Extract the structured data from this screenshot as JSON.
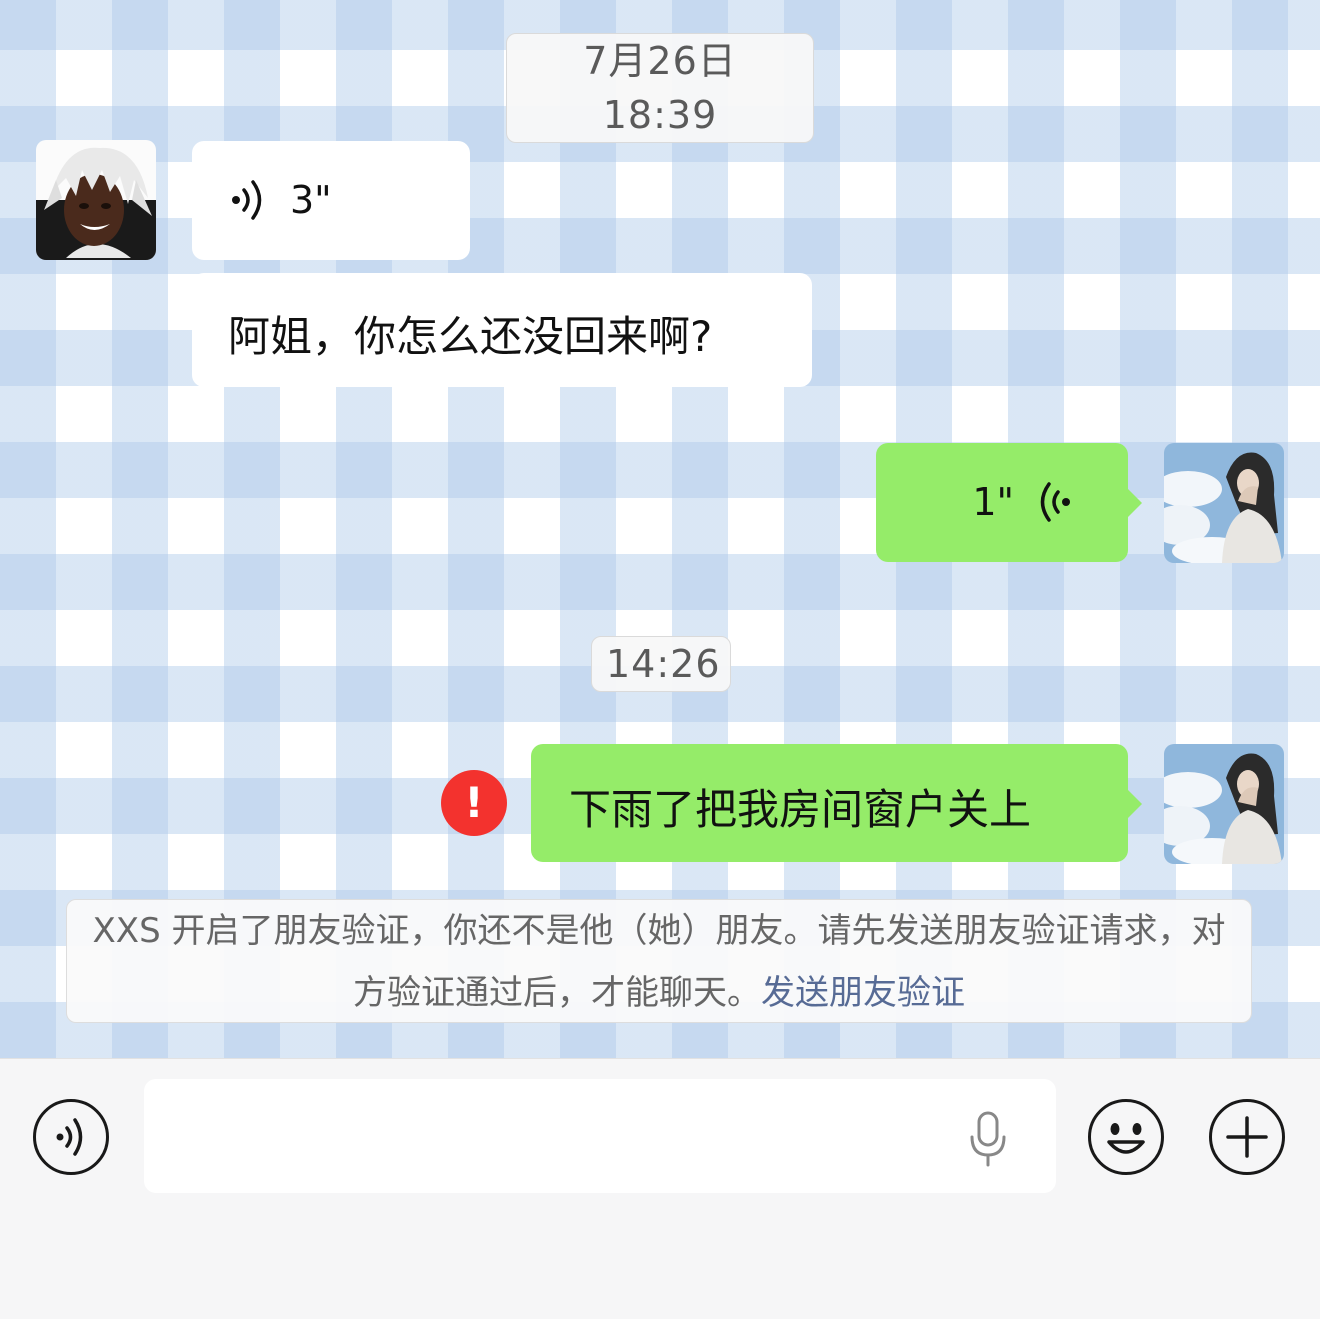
{
  "chat": {
    "timestamps": [
      "7月26日 18:39",
      "14:26"
    ],
    "messages": [
      {
        "voice_duration": "3\""
      },
      {
        "text": "阿姐，你怎么还没回来啊?"
      },
      {
        "voice_duration": "1\""
      },
      {
        "text": "下雨了把我房间窗户关上"
      }
    ],
    "system_notice": {
      "text": "XXS 开启了朋友验证，你还不是他（她）朋友。请先发送朋友验证请求，对方验证通过后，才能聊天。",
      "link": "发送朋友验证"
    },
    "error_mark": "!"
  },
  "colors": {
    "outgoing_bubble": "#95ec69",
    "incoming_bubble": "#ffffff",
    "error_red": "#f3322e",
    "link_blue": "#576b95"
  },
  "icons": {
    "voice_toggle": "voice-mode-icon",
    "microphone": "microphone-icon",
    "emoji": "emoji-icon",
    "more": "plus-icon"
  }
}
